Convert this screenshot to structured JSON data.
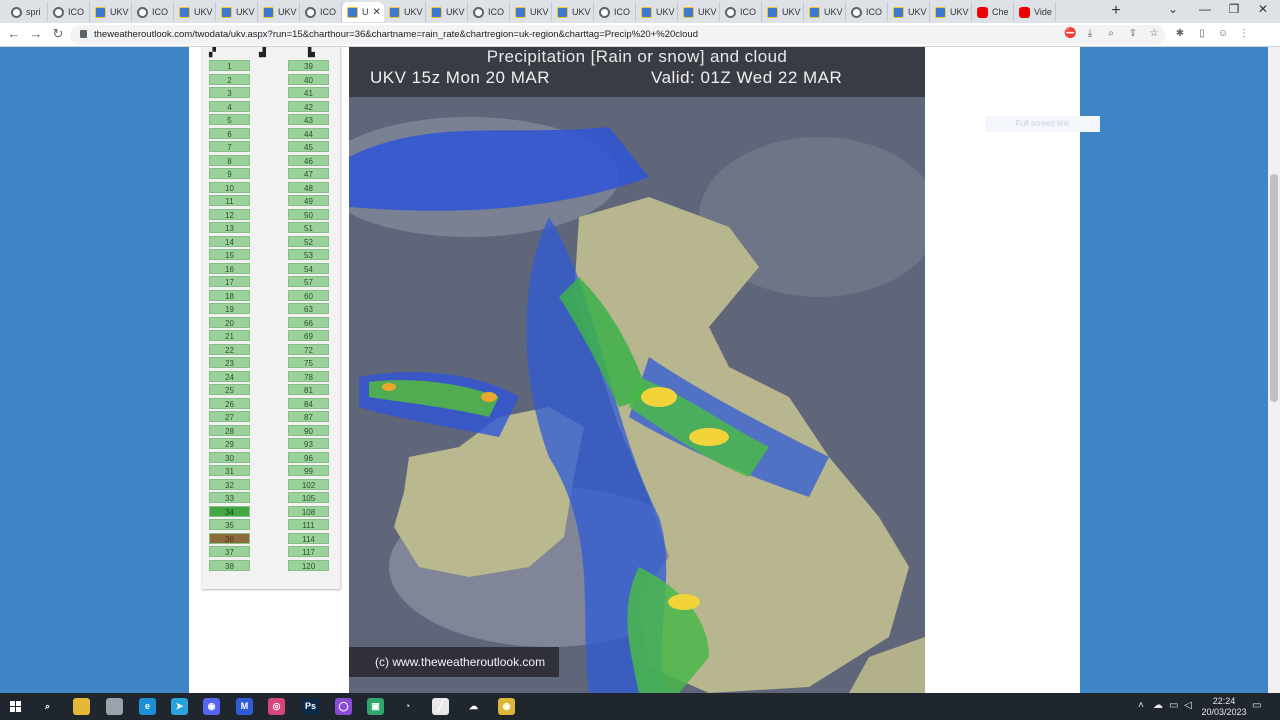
{
  "browser": {
    "tabs": [
      {
        "label": "spri",
        "favicon": "globe"
      },
      {
        "label": "ICO",
        "favicon": "globe"
      },
      {
        "label": "UKV",
        "favicon": "ukv"
      },
      {
        "label": "ICO",
        "favicon": "globe"
      },
      {
        "label": "UKV",
        "favicon": "ukv"
      },
      {
        "label": "UKV",
        "favicon": "ukv"
      },
      {
        "label": "UKV",
        "favicon": "ukv"
      },
      {
        "label": "ICO",
        "favicon": "globe"
      },
      {
        "label": "U",
        "favicon": "ukv",
        "active": true,
        "close": "✕"
      },
      {
        "label": "UKV",
        "favicon": "ukv"
      },
      {
        "label": "UKV",
        "favicon": "ukv"
      },
      {
        "label": "ICO",
        "favicon": "globe"
      },
      {
        "label": "UKV",
        "favicon": "ukv"
      },
      {
        "label": "UKV",
        "favicon": "ukv"
      },
      {
        "label": "ICO",
        "favicon": "globe"
      },
      {
        "label": "UKV",
        "favicon": "ukv"
      },
      {
        "label": "UKV",
        "favicon": "ukv"
      },
      {
        "label": "ICO",
        "favicon": "globe"
      },
      {
        "label": "UKV",
        "favicon": "ukv"
      },
      {
        "label": "UKV",
        "favicon": "ukv"
      },
      {
        "label": "ICO",
        "favicon": "globe"
      },
      {
        "label": "UKV",
        "favicon": "ukv"
      },
      {
        "label": "UKV",
        "favicon": "ukv"
      },
      {
        "label": "Che",
        "favicon": "yt"
      },
      {
        "label": "Vide",
        "favicon": "yt"
      }
    ],
    "new_tab_label": "+",
    "window_controls": {
      "dropdown": "⌄",
      "minimize": "—",
      "restore": "❐",
      "close": "✕"
    },
    "nav": {
      "back": "←",
      "forward": "→",
      "reload": "↻"
    },
    "url": "theweatheroutlook.com/twodata/ukv.aspx?run=15&charthour=36&chartname=rain_rate&chartregion=uk-region&charttag=Precip%20+%20cloud",
    "toolbar_icons": [
      "adblock-icon",
      "download-icon",
      "zoom-icon",
      "share-icon",
      "star-icon",
      "extension-puzzle-icon",
      "sidebar-icon",
      "profile-avatar-icon",
      "menu-dots-icon"
    ]
  },
  "page": {
    "column_head_left": "▞",
    "column_head_mid": "▟",
    "column_head_right": "▙",
    "hours_left": [
      "1",
      "2",
      "3",
      "4",
      "5",
      "6",
      "7",
      "8",
      "9",
      "10",
      "11",
      "12",
      "13",
      "14",
      "15",
      "16",
      "17",
      "18",
      "19",
      "20",
      "21",
      "22",
      "23",
      "24",
      "25",
      "26",
      "27",
      "28",
      "29",
      "30",
      "31",
      "32",
      "33",
      "34",
      "35",
      "36",
      "37",
      "38"
    ],
    "hours_right": [
      "39",
      "40",
      "41",
      "42",
      "43",
      "44",
      "45",
      "46",
      "47",
      "48",
      "49",
      "50",
      "51",
      "52",
      "53",
      "54",
      "57",
      "60",
      "63",
      "66",
      "69",
      "72",
      "75",
      "78",
      "81",
      "84",
      "87",
      "90",
      "93",
      "96",
      "99",
      "102",
      "105",
      "108",
      "111",
      "114",
      "117",
      "120"
    ],
    "current_hour": "34",
    "selected_hour": "36",
    "fullscreen_label": "Full screen link",
    "colors": {
      "page_bg": "#3f86c6",
      "hour_cell": "#9bd29b",
      "current_cell": "#43a843",
      "selected_cell": "#8c6a3c"
    }
  },
  "chart": {
    "title": "Precipitation [Rain or snow] and cloud",
    "run_label": "UKV 15z Mon 20 MAR",
    "valid_label": "Valid: 01Z Wed 22 MAR",
    "credit": "(c) www.theweatheroutlook.com"
  },
  "taskbar": {
    "apps": [
      {
        "name": "windows-start-icon",
        "label": "",
        "color": "#20262e"
      },
      {
        "name": "search-icon",
        "label": "⌕",
        "color": "#20262e"
      },
      {
        "name": "file-explorer-icon",
        "label": "",
        "color": "#e6b83a"
      },
      {
        "name": "app-icon",
        "label": "",
        "color": "#9aa3ad"
      },
      {
        "name": "edge-icon",
        "label": "e",
        "color": "#1d8fd6"
      },
      {
        "name": "telegram-icon",
        "label": "➤",
        "color": "#2aa3dc"
      },
      {
        "name": "discord-icon",
        "label": "◉",
        "color": "#5865f2"
      },
      {
        "name": "malwarebytes-icon",
        "label": "M",
        "color": "#2f5bd7"
      },
      {
        "name": "instagram-icon",
        "label": "◎",
        "color": "#d6467a"
      },
      {
        "name": "photoshop-icon",
        "label": "Ps",
        "color": "#0b2a4a"
      },
      {
        "name": "circle-app-icon",
        "label": "◯",
        "color": "#8a4bd6"
      },
      {
        "name": "green-app-icon",
        "label": "▣",
        "color": "#2fa66a"
      },
      {
        "name": "gauge-app-icon",
        "label": "◔",
        "color": "#20262e"
      },
      {
        "name": "paint-app-icon",
        "label": "╱",
        "color": "#e8e8e8"
      },
      {
        "name": "cloud-app-icon",
        "label": "☁",
        "color": "#20262e"
      },
      {
        "name": "chrome-icon",
        "label": "◉",
        "color": "#ddb73a"
      }
    ],
    "tray_icons": [
      "chevron-up-icon",
      "onedrive-icon",
      "network-icon",
      "volume-icon"
    ],
    "time": "22:24",
    "date": "20/03/2023",
    "notification": "▭"
  }
}
